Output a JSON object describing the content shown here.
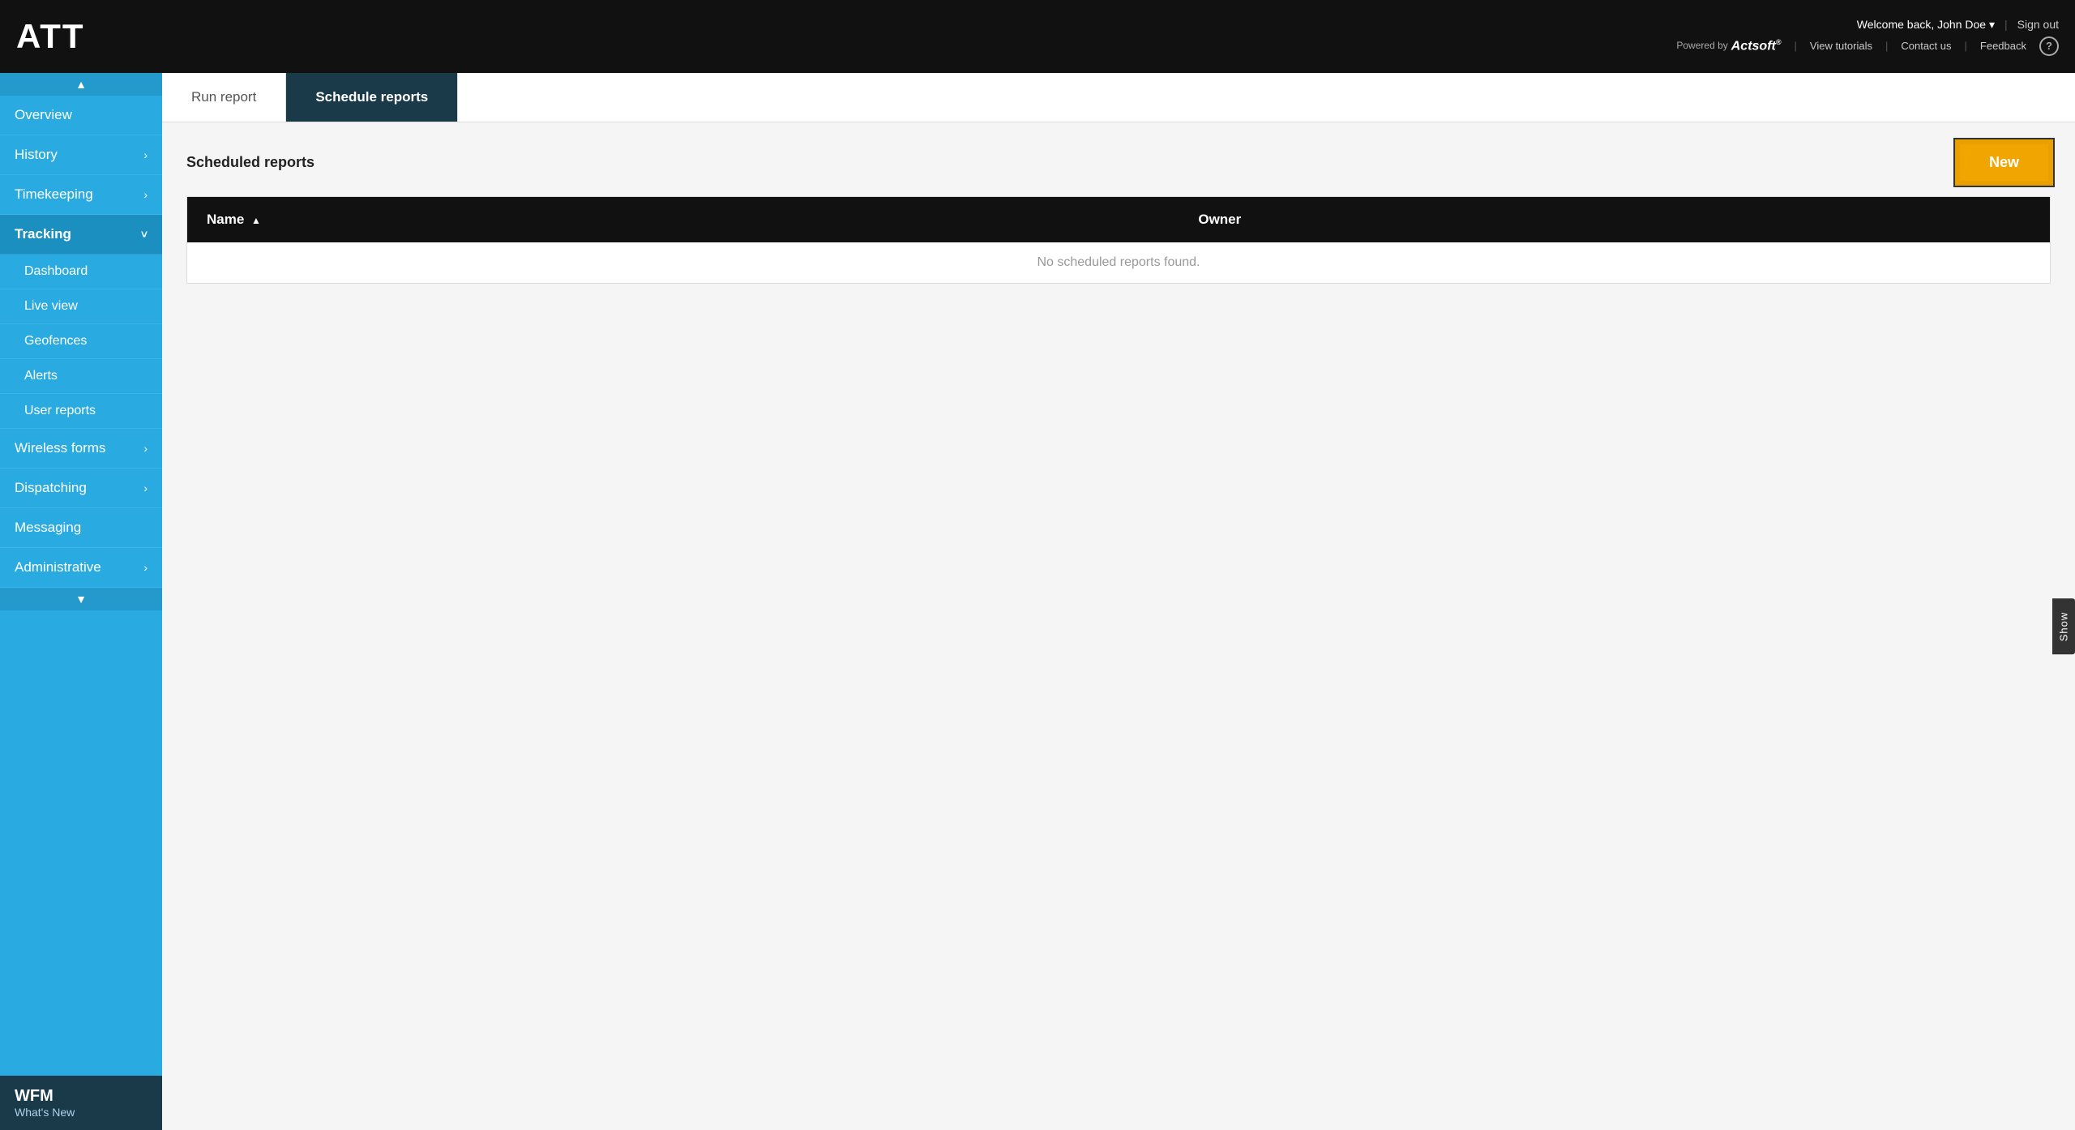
{
  "header": {
    "logo": "ATT",
    "welcome_text": "Welcome back, John Doe",
    "chevron": "▾",
    "sign_out_label": "Sign out",
    "powered_by": "Powered by",
    "actsoft_brand": "Actsoft",
    "view_tutorials": "View tutorials",
    "contact_us": "Contact us",
    "feedback": "Feedback",
    "help_icon": "?"
  },
  "sidebar": {
    "scroll_up": "▲",
    "scroll_down": "▼",
    "items": [
      {
        "label": "Overview",
        "has_chevron": false,
        "active": false
      },
      {
        "label": "History",
        "has_chevron": true,
        "active": false
      },
      {
        "label": "Timekeeping",
        "has_chevron": true,
        "active": false
      },
      {
        "label": "Tracking",
        "has_chevron": true,
        "active": true,
        "expanded": true
      },
      {
        "label": "Dashboard",
        "is_sub": true
      },
      {
        "label": "Live view",
        "is_sub": true
      },
      {
        "label": "Geofences",
        "is_sub": true
      },
      {
        "label": "Alerts",
        "is_sub": true
      },
      {
        "label": "User reports",
        "is_sub": true,
        "highlight": true
      },
      {
        "label": "Wireless forms",
        "has_chevron": true,
        "active": false
      },
      {
        "label": "Dispatching",
        "has_chevron": true,
        "active": false
      },
      {
        "label": "Messaging",
        "has_chevron": false,
        "active": false
      },
      {
        "label": "Administrative",
        "has_chevron": true,
        "active": false
      }
    ],
    "bottom": {
      "title": "WFM",
      "subtitle": "What's New"
    }
  },
  "tabs": [
    {
      "label": "Run report",
      "active": false
    },
    {
      "label": "Schedule reports",
      "active": true
    }
  ],
  "page": {
    "section_title": "Scheduled reports",
    "new_button_label": "New",
    "table": {
      "columns": [
        {
          "label": "Name",
          "sort_icon": "▲"
        },
        {
          "label": "Owner",
          "sort_icon": ""
        }
      ],
      "empty_message": "No scheduled reports found."
    }
  },
  "show_panel": {
    "label": "Show"
  }
}
